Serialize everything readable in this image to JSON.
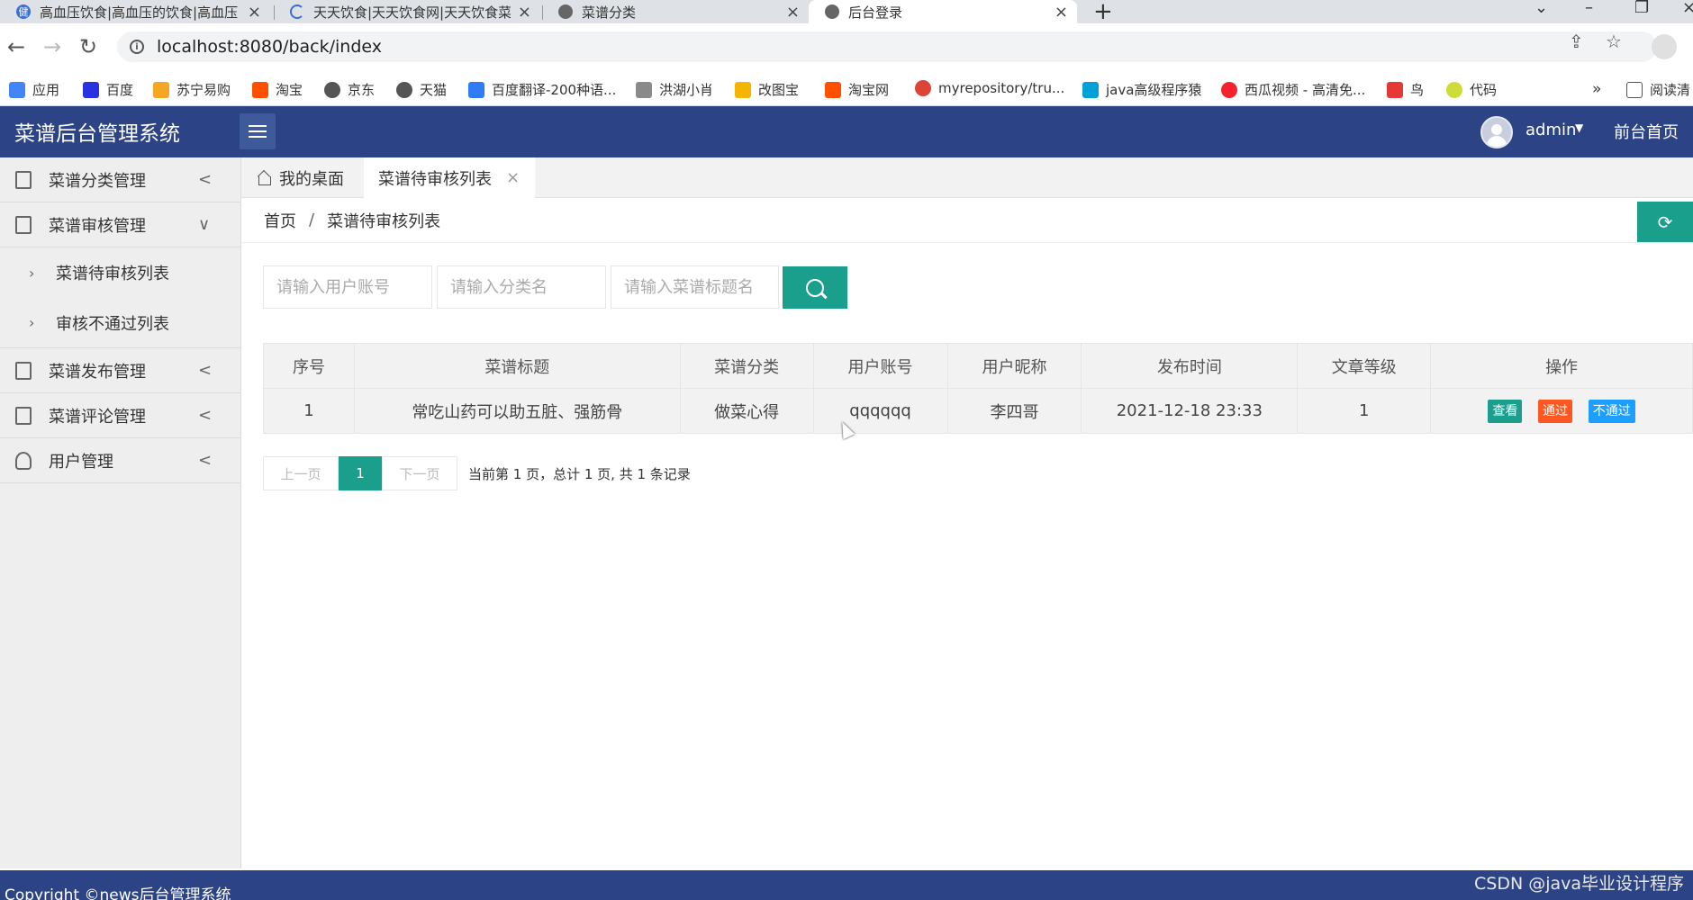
{
  "browser": {
    "tabs": [
      {
        "label": "高血压饮食|高血压的饮食|高血压",
        "favicon": "site-icon-blue",
        "fav_text": "健"
      },
      {
        "label": "天天饮食|天天饮食网|天天饮食菜",
        "favicon": "loading-spinner-icon",
        "fav_text": ""
      },
      {
        "label": "菜谱分类",
        "favicon": "globe-icon",
        "fav_text": ""
      },
      {
        "label": "后台登录",
        "favicon": "globe-icon",
        "fav_text": ""
      }
    ],
    "url": "localhost:8080/back/index",
    "bookmarks": [
      {
        "label": "应用",
        "color": "#4285f4"
      },
      {
        "label": "百度",
        "color": "#2932e1"
      },
      {
        "label": "苏宁易购",
        "color": "#f5a623"
      },
      {
        "label": "淘宝",
        "color": "#ff5000"
      },
      {
        "label": "京东",
        "color": "#555555"
      },
      {
        "label": "天猫",
        "color": "#555555"
      },
      {
        "label": "百度翻译-200种语...",
        "color": "#2f7cf6"
      },
      {
        "label": "洪湖小肖",
        "color": "#8a8a8a"
      },
      {
        "label": "改图宝",
        "color": "#f4b400"
      },
      {
        "label": "淘宝网",
        "color": "#ff5000"
      },
      {
        "label": "myrepository/tru...",
        "color": "#db4437"
      },
      {
        "label": "java高级程序猿",
        "color": "#00a1d6"
      },
      {
        "label": "西瓜视频 - 高清免...",
        "color": "#f5222d"
      },
      {
        "label": "鸟",
        "color": "#e53935"
      },
      {
        "label": "代码",
        "color": "#cddc39"
      }
    ],
    "bookmark_overflow": "»",
    "reading_list": "阅读清"
  },
  "header": {
    "title": "菜谱后台管理系统",
    "user": "admin",
    "front_link": "前台首页"
  },
  "sidebar": {
    "items": [
      {
        "label": "菜谱分类管理",
        "arrow": "<"
      },
      {
        "label": "菜谱审核管理",
        "arrow": "∨"
      },
      {
        "label": "菜谱发布管理",
        "arrow": "<"
      },
      {
        "label": "菜谱评论管理",
        "arrow": "<"
      },
      {
        "label": "用户管理",
        "arrow": "<"
      }
    ],
    "sub_items": [
      {
        "label": "菜谱待审核列表"
      },
      {
        "label": "审核不通过列表"
      }
    ]
  },
  "page_tabs": [
    {
      "label": "我的桌面"
    },
    {
      "label": "菜谱待审核列表",
      "close": "×"
    }
  ],
  "breadcrumb": {
    "home": "首页",
    "sep": "/",
    "current": "菜谱待审核列表"
  },
  "search": {
    "account_placeholder": "请输入用户账号",
    "category_placeholder": "请输入分类名",
    "title_placeholder": "请输入菜谱标题名"
  },
  "table": {
    "columns": [
      "序号",
      "菜谱标题",
      "菜谱分类",
      "用户账号",
      "用户昵称",
      "发布时间",
      "文章等级",
      "操作"
    ],
    "rows": [
      {
        "index": "1",
        "title": "常吃山药可以助五脏、强筋骨",
        "category": "做菜心得",
        "account": "qqqqqq",
        "nickname": "李四哥",
        "time": "2021-12-18 23:33",
        "level": "1"
      }
    ],
    "actions": {
      "view": "查看",
      "pass": "通过",
      "reject": "不通过"
    }
  },
  "pagination": {
    "prev": "上一页",
    "current": "1",
    "next": "下一页",
    "info": "当前第 1 页，总计 1 页, 共 1 条记录"
  },
  "footer": {
    "text": "Copyright ©news后台管理系统"
  },
  "watermark": "CSDN @java毕业设计程序",
  "colors": {
    "header": "#2c4485",
    "accent": "#1a9f8c",
    "pass": "#ff5722",
    "reject": "#1e9fff"
  }
}
